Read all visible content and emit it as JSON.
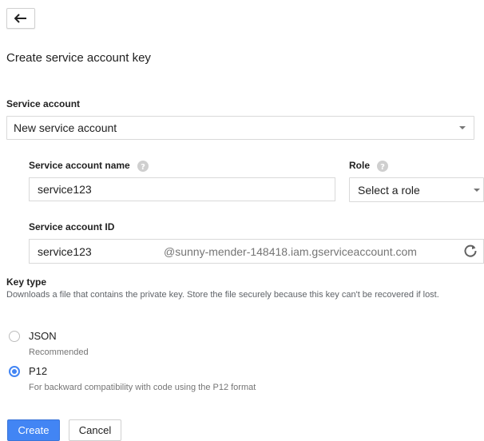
{
  "page": {
    "title": "Create service account key"
  },
  "service_account": {
    "label": "Service account",
    "selected": "New service account"
  },
  "name_field": {
    "label": "Service account name",
    "value": "service123"
  },
  "role_field": {
    "label": "Role",
    "selected": "Select a role"
  },
  "id_field": {
    "label": "Service account ID",
    "value": "service123",
    "suffix": "@sunny-mender-148418.iam.gserviceaccount.com"
  },
  "key_type": {
    "label": "Key type",
    "description": "Downloads a file that contains the private key. Store the file securely because this key can't be recovered if lost.",
    "options": [
      {
        "label": "JSON",
        "sub": "Recommended",
        "selected": false
      },
      {
        "label": "P12",
        "sub": "For backward compatibility with code using the P12 format",
        "selected": true
      }
    ]
  },
  "actions": {
    "create_label": "Create",
    "cancel_label": "Cancel"
  },
  "colors": {
    "accent": "#4285f4",
    "text": "#212121",
    "muted": "#757575",
    "border": "#d9d9d9"
  },
  "icons": {
    "back": "arrow-back-icon",
    "help": "help-icon",
    "refresh": "refresh-icon",
    "dropdown": "chevron-down-icon"
  }
}
